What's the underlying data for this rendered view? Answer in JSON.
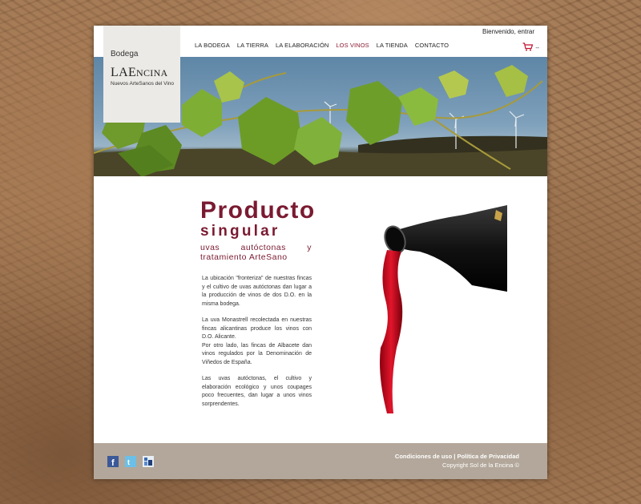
{
  "header": {
    "welcome_text": "Bienvenido,",
    "login_link": "entrar",
    "cart_count": "--"
  },
  "logo": {
    "line1": "Bodega",
    "brand_la": "LA",
    "brand_e": "E",
    "brand_ncina": "NCINA",
    "tagline": "Nuevos ArteSanos del Vino"
  },
  "nav": {
    "items": [
      "LA BODEGA",
      "LA TIERRA",
      "LA ELABORACIÓN",
      "LOS VINOS",
      "LA TIENDA",
      "CONTACTO"
    ],
    "active": "LOS VINOS"
  },
  "content": {
    "title1": "Producto",
    "title2": "singular",
    "subtitle": "uvas autóctonas y tratamiento ArteSano",
    "p1": "La ubicación \"fronteriza\" de nuestras fincas y el cultivo de uvas autóctonas dan lugar a la producción de vinos de dos D.O. en la misma bodega.",
    "p2a": "La uva Monastrell recolectada en nuestras fincas alicantinas produce los vinos con D.O. Alicante.",
    "p2b": "Por otro lado, las fincas de Albacete dan vinos regulados por la Denominación de Viñedos de España.",
    "p3": "Las uvas autóctonas, el cultivo y elaboración ecológico y unos coupages poco frecuentes, dan lugar a unos vinos sorprendentes."
  },
  "footer": {
    "terms": "Condiciones de uso",
    "separator": "|",
    "privacy": "Política de Privacidad",
    "copyright": "Copyright Sol de la Encina ©"
  },
  "colors": {
    "accent": "#7a1a31",
    "nav_active": "#8a1a33",
    "footer_bg": "#b2a79a",
    "logo_bg": "#eceae6"
  },
  "icons": {
    "cart": "cart-icon",
    "facebook": "facebook-icon",
    "twitter": "twitter-icon",
    "share": "share-icon"
  }
}
